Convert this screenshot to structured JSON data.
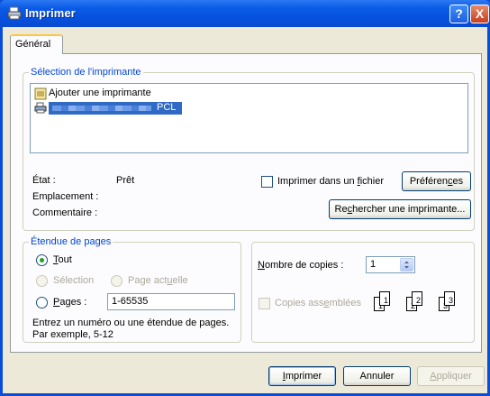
{
  "window": {
    "title": "Imprimer",
    "help_label": "?",
    "close_label": "X"
  },
  "tabs": [
    {
      "label": "Général"
    }
  ],
  "printer_selection": {
    "legend": "Sélection de l'imprimante",
    "items": [
      {
        "label": "Ajouter une imprimante"
      },
      {
        "label": "PCL"
      }
    ]
  },
  "status": {
    "state_label": "État :",
    "state_value": "Prêt",
    "location_label": "Emplacement :",
    "comment_label": "Commentaire :"
  },
  "print_to_file": {
    "label_pre": "Imprimer dans un ",
    "label_ul": "f",
    "label_post": "ichier",
    "checked": false
  },
  "preferences_button": {
    "pre": "Préféren",
    "ul": "c",
    "post": "es"
  },
  "find_printer_button": {
    "pre": "Re",
    "ul": "c",
    "post": "hercher une imprimante..."
  },
  "page_range": {
    "legend": "Étendue de pages",
    "all": {
      "ul": "T",
      "post": "out",
      "selected": true
    },
    "selection": {
      "label": "Sélection"
    },
    "current_page": {
      "pre": "Page act",
      "ul": "u",
      "post": "elle"
    },
    "pages": {
      "ul": "P",
      "post": "ages :",
      "value": "1-65535"
    },
    "hint_line1": "Entrez un numéro ou une étendue de pages.",
    "hint_line2": "Par exemple, 5-12"
  },
  "copies": {
    "label_ul": "N",
    "label_post": "ombre de copies :",
    "value": "1",
    "collate_pre": "Copies ass",
    "collate_ul": "e",
    "collate_post": "mblées",
    "collate_checked": false,
    "collate_pages": [
      "1",
      "1",
      "2",
      "2",
      "3",
      "3"
    ]
  },
  "footer": {
    "print": {
      "ul": "I",
      "post": "mprimer"
    },
    "cancel": {
      "label": "Annuler"
    },
    "apply": {
      "ul": "A",
      "post": "ppliquer"
    }
  },
  "colors": {
    "titlebar": "#0b5be6",
    "dialog_bg": "#ece9d8",
    "legend_text": "#0046d5",
    "selection": "#316ac5",
    "radio_dot": "#21a121"
  }
}
